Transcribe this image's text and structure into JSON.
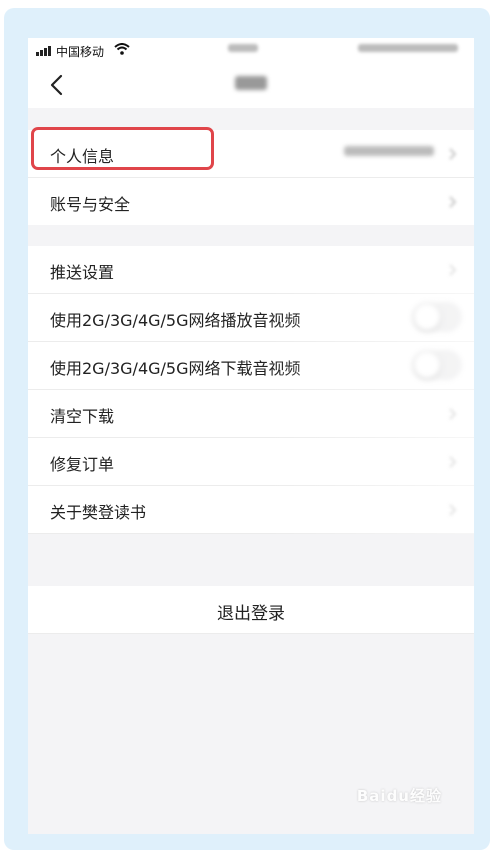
{
  "status_bar": {
    "carrier": "中国移动"
  },
  "nav": {
    "back_icon": "chevron-left-icon"
  },
  "groups": {
    "account": [
      {
        "label": "个人信息"
      },
      {
        "label": "账号与安全"
      }
    ],
    "settings": [
      {
        "label": "推送设置"
      },
      {
        "label": "使用2G/3G/4G/5G网络播放音视频",
        "toggle": false
      },
      {
        "label": "使用2G/3G/4G/5G网络下载音视频",
        "toggle": false
      },
      {
        "label": "清空下载"
      },
      {
        "label": "修复订单"
      },
      {
        "label": "关于樊登读书"
      }
    ]
  },
  "logout": {
    "label": "退出登录"
  },
  "highlight_color": "#e0454a",
  "watermark": "Baidu经验"
}
